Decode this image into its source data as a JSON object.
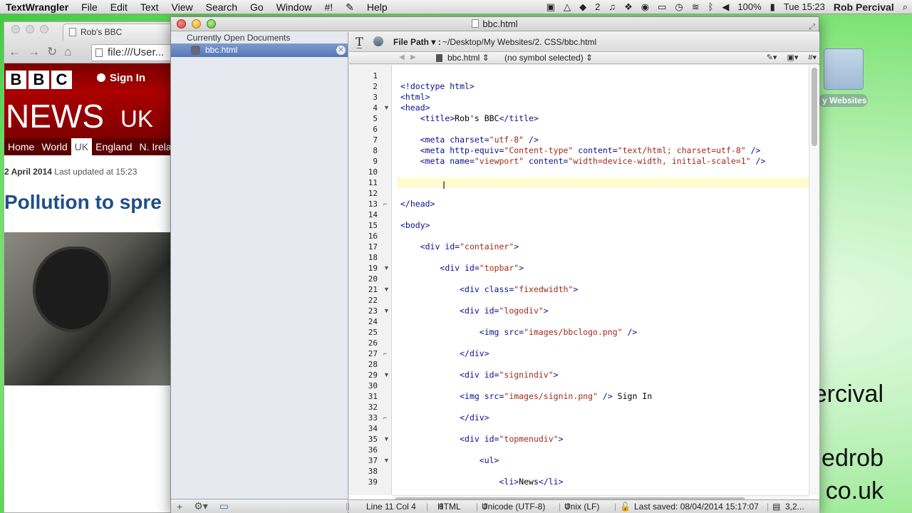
{
  "menubar": {
    "app": "TextWrangler",
    "items": [
      "File",
      "Edit",
      "Text",
      "View",
      "Search",
      "Go",
      "Window",
      "#!",
      "Help"
    ],
    "status_count": "2",
    "battery": "100%",
    "clock": "Tue 15:23",
    "user": "Rob Percival"
  },
  "desktop": {
    "folder_label": "y Websites",
    "text_lines": [
      "ercival",
      "edrob",
      "co.uk"
    ]
  },
  "browser": {
    "tab_title": "Rob's BBC",
    "url": "file:///User...",
    "bbc_logo": [
      "B",
      "B",
      "C"
    ],
    "signin": "Sign In",
    "news": "NEWS",
    "uk": "UK",
    "menu": [
      "Home",
      "World",
      "UK",
      "England",
      "N. Irela"
    ],
    "date": "2 April 2014",
    "updated": "Last updated at 15:23",
    "headline": "Pollution to spre"
  },
  "editor": {
    "window_title": "bbc.html",
    "sidebar_header": "Currently Open Documents",
    "open_doc": "bbc.html",
    "file_path_label": "File Path ▾ :",
    "file_path": "~/Desktop/My Websites/2. CSS/bbc.html",
    "nav_file": "bbc.html",
    "nav_symbol": "(no symbol selected)",
    "status": {
      "position": "Line 11 Col 4",
      "language": "HTML",
      "encoding": "Unicode (UTF-8)",
      "line_endings": "Unix (LF)",
      "saved": "Last saved: 08/04/2014 15:17:07",
      "extra": "3,2..."
    },
    "lines": [
      "",
      "<!doctype html>",
      "<html>",
      "<head>",
      "    <title>Rob's BBC</title>",
      "",
      "    <meta charset=\"utf-8\" />",
      "    <meta http-equiv=\"Content-type\" content=\"text/html; charset=utf-8\" />",
      "    <meta name=\"viewport\" content=\"width=device-width, initial-scale=1\" />",
      "",
      "",
      "",
      "</head>",
      "",
      "<body>",
      "",
      "    <div id=\"container\">",
      "",
      "        <div id=\"topbar\">",
      "",
      "            <div class=\"fixedwidth\">",
      "",
      "            <div id=\"logodiv\">",
      "",
      "                <img src=\"images/bbclogo.png\" />",
      "",
      "            </div>",
      "",
      "            <div id=\"signindiv\">",
      "",
      "            <img src=\"images/signin.png\" /> Sign In",
      "",
      "            </div>",
      "",
      "            <div id=\"topmenudiv\">",
      "",
      "                <ul>",
      "",
      "                    <li>News</li>"
    ],
    "folds": {
      "4": "open",
      "13": "close",
      "19": "open",
      "21": "open",
      "23": "open",
      "27": "close",
      "29": "open",
      "33": "close",
      "35": "open",
      "37": "open"
    }
  }
}
